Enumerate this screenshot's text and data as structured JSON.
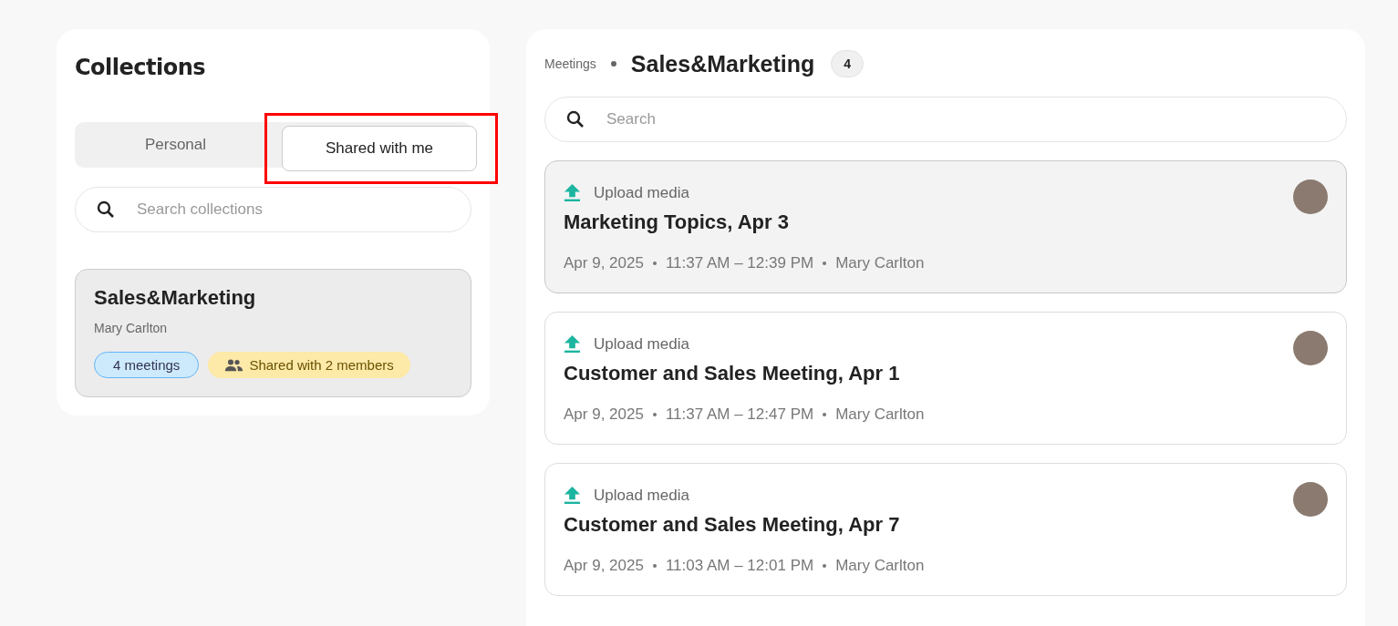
{
  "collections": {
    "title": "Collections",
    "tabs": [
      {
        "label": "Personal",
        "selected": false,
        "highlighted": false
      },
      {
        "label": "Shared with me",
        "selected": true,
        "highlighted": true
      }
    ],
    "search": {
      "placeholder": "Search collections"
    },
    "items": [
      {
        "name": "Sales&Marketing",
        "owner": "Mary Carlton",
        "meetings": "4 meetings",
        "shared": "Shared with 2 members",
        "selected": true
      }
    ]
  },
  "meetings": {
    "breadcrumb": "Meetings",
    "title": "Sales&Marketing",
    "count": "4",
    "search": {
      "placeholder": "Search"
    },
    "items": [
      {
        "status": "Upload media",
        "title": "Marketing Topics, Apr 3",
        "date": "Apr 9, 2025",
        "time": "11:37 AM – 12:39 PM",
        "owner": "Mary Carlton",
        "selected": true
      },
      {
        "status": "Upload media",
        "title": "Customer and Sales Meeting, Apr 1",
        "date": "Apr 9, 2025",
        "time": "11:37 AM – 12:47 PM",
        "owner": "Mary Carlton",
        "selected": false
      },
      {
        "status": "Upload media",
        "title": "Customer and Sales Meeting, Apr 7",
        "date": "Apr 9, 2025",
        "time": "11:03 AM – 12:01 PM",
        "owner": "Mary Carlton",
        "selected": false
      }
    ]
  }
}
